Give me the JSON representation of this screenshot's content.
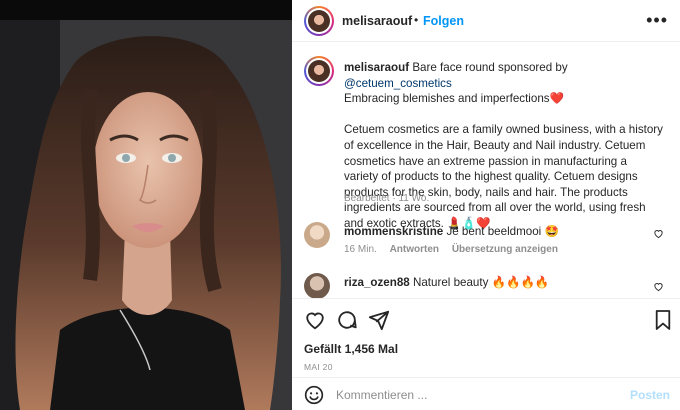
{
  "post": {
    "username": "melisaraouf",
    "separator": "•",
    "follow_label": "Folgen",
    "more_label": "•••"
  },
  "caption": {
    "username": "melisaraouf",
    "line1": "Bare face round sponsored by",
    "mention": "@cetuem_cosmetics",
    "line2": "Embracing blemishes and imperfections",
    "line2_emoji": "❤️",
    "body": "Cetuem cosmetics are a family owned business, with a history of excellence in the Hair, Beauty and Nail industry. Cetuem cosmetics have an extreme passion in manufacturing a variety of products to the highest quality. Cetuem designs products for the skin, body, nails and hair. The products ingredients are sourced from all over the world, using fresh and exotic extracts.",
    "body_emoji": "💄🧴❤️",
    "meta": "Bearbeitet · 11 Wo."
  },
  "comments": [
    {
      "username": "mommenskristine",
      "text": "Je bent beeldmooi",
      "emoji": "🤩",
      "time": "16 Min.",
      "reply": "Antworten",
      "translate": "Übersetzung anzeigen"
    },
    {
      "username": "riza_ozen88",
      "text": "Naturel beauty",
      "emoji": "🔥🔥🔥🔥"
    }
  ],
  "likes": "Gefällt 1,456 Mal",
  "date": "MAI 20",
  "add_comment": {
    "placeholder": "Kommentieren ...",
    "post_label": "Posten"
  },
  "colors": {
    "link_blue": "#0095f6",
    "post_disabled": "#b2dffc",
    "text": "#262626",
    "muted": "#8e8e8e"
  }
}
